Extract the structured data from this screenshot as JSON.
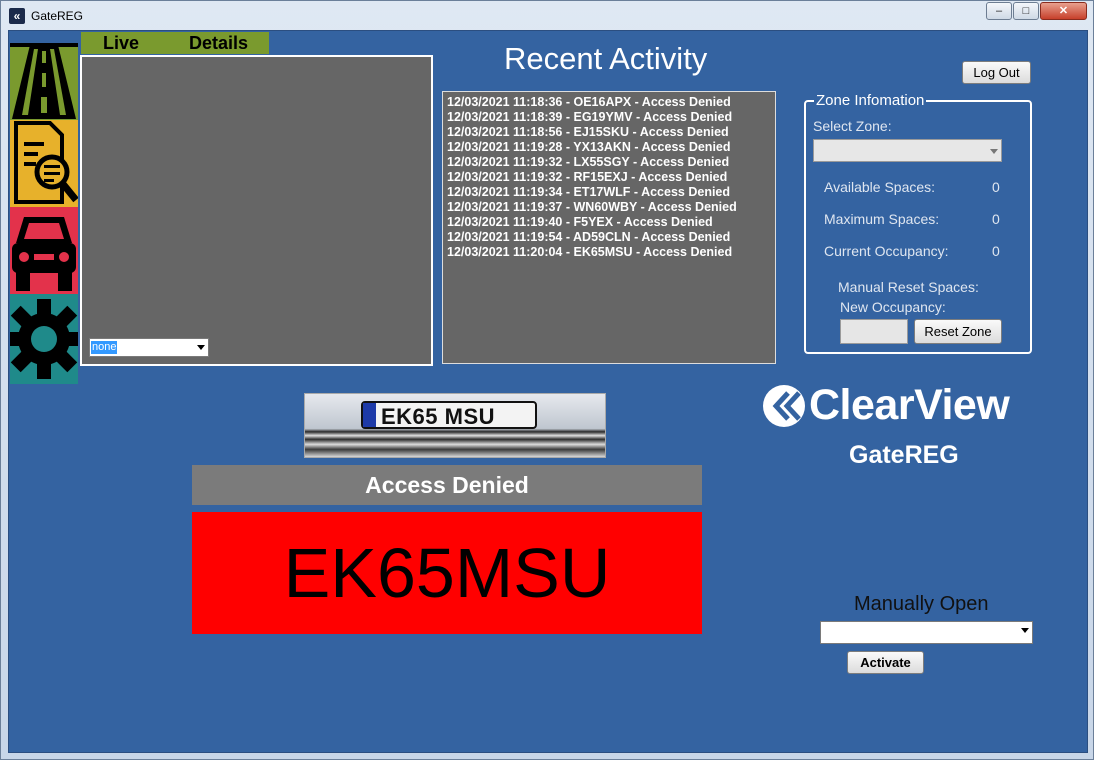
{
  "window": {
    "title": "GateREG",
    "minimize": "‒",
    "maximize": "□",
    "close": "✕"
  },
  "nav": {
    "items": [
      "road-icon",
      "search-document-icon",
      "car-icon",
      "gear-icon"
    ]
  },
  "tabs": [
    {
      "label": "Live"
    },
    {
      "label": "Details"
    }
  ],
  "camera": {
    "selected": "none"
  },
  "recent": {
    "title": "Recent Activity",
    "entries": [
      "12/03/2021 11:18:36 - OE16APX - Access Denied",
      "12/03/2021 11:18:39 - EG19YMV - Access Denied",
      "12/03/2021 11:18:56 - EJ15SKU - Access Denied",
      "12/03/2021 11:19:28 - YX13AKN - Access Denied",
      "12/03/2021 11:19:32 - LX55SGY - Access Denied",
      "12/03/2021 11:19:32 - RF15EXJ - Access Denied",
      "12/03/2021 11:19:34 - ET17WLF - Access Denied",
      "12/03/2021 11:19:37 - WN60WBY - Access Denied",
      "12/03/2021 11:19:40 - F5YEX - Access Denied",
      "12/03/2021 11:19:54 - AD59CLN - Access Denied",
      "12/03/2021 11:20:04 - EK65MSU - Access Denied"
    ]
  },
  "header": {
    "logout_label": "Log Out"
  },
  "zone": {
    "legend": "Zone Infomation",
    "select_label": "Select Zone:",
    "selected": "",
    "available_label": "Available Spaces:",
    "available_value": "0",
    "maximum_label": "Maximum Spaces:",
    "maximum_value": "0",
    "current_label": "Current Occupancy:",
    "current_value": "0",
    "manual_reset_label": "Manual Reset Spaces:",
    "new_occupancy_label": "New Occupancy:",
    "new_occupancy_value": "",
    "reset_label": "Reset Zone"
  },
  "capture": {
    "plate_image_text": "EK65 MSU",
    "status": "Access Denied",
    "plate": "EK65MSU"
  },
  "brand": {
    "name": "ClearView",
    "product": "GateREG"
  },
  "manual": {
    "title": "Manually Open",
    "selected": "",
    "activate_label": "Activate"
  },
  "colors": {
    "background": "#3463a1",
    "denied": "#ff0000",
    "status_bar": "#7b7b7b",
    "nav_road": "#7a9a2e",
    "nav_search": "#e7b12b",
    "nav_car": "#e3324b",
    "nav_gear": "#1f8a8a"
  }
}
